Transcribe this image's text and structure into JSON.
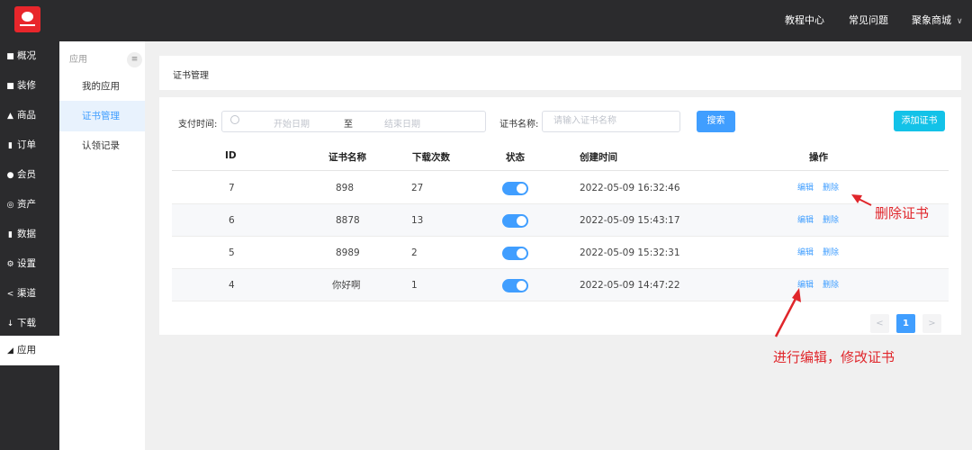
{
  "header": {
    "nav": [
      "教程中心",
      "常见问题",
      "聚象商城"
    ],
    "colors": {
      "bar": "#2b2b2d",
      "logo": "#e8262b"
    }
  },
  "sidebar": {
    "items": [
      {
        "label": "概况",
        "icon": "monitor-icon"
      },
      {
        "label": "装修",
        "icon": "monitor-icon"
      },
      {
        "label": "商品",
        "icon": "shop-icon"
      },
      {
        "label": "订单",
        "icon": "document-icon"
      },
      {
        "label": "会员",
        "icon": "user-icon"
      },
      {
        "label": "资产",
        "icon": "database-icon"
      },
      {
        "label": "数据",
        "icon": "bar-chart-icon"
      },
      {
        "label": "设置",
        "icon": "gear-icon"
      },
      {
        "label": "渠道",
        "icon": "share-icon"
      },
      {
        "label": "下载",
        "icon": "download-icon"
      },
      {
        "label": "应用",
        "icon": "app-icon",
        "active": true
      }
    ]
  },
  "subnav": {
    "title": "应用",
    "items": [
      {
        "label": "我的应用"
      },
      {
        "label": "证书管理",
        "active": true
      },
      {
        "label": "认领记录"
      }
    ]
  },
  "page": {
    "breadcrumb": "证书管理"
  },
  "filters": {
    "pay_time_label": "支付时间:",
    "start_placeholder": "开始日期",
    "range_sep": "至",
    "end_placeholder": "结束日期",
    "cert_name_label": "证书名称:",
    "cert_name_placeholder": "请输入证书名称",
    "search_label": "搜索",
    "add_label": "添加证书"
  },
  "table": {
    "headers": [
      "ID",
      "证书名称",
      "下载次数",
      "状态",
      "创建时间",
      "操作"
    ],
    "rows": [
      {
        "id": "7",
        "name": "898",
        "downloads": "27",
        "enabled": true,
        "created": "2022-05-09 16:32:46",
        "edit": "编辑",
        "delete": "删除"
      },
      {
        "id": "6",
        "name": "8878",
        "downloads": "13",
        "enabled": true,
        "created": "2022-05-09 15:43:17",
        "edit": "编辑",
        "delete": "删除"
      },
      {
        "id": "5",
        "name": "8989",
        "downloads": "2",
        "enabled": true,
        "created": "2022-05-09 15:32:31",
        "edit": "编辑",
        "delete": "删除"
      },
      {
        "id": "4",
        "name": "你好啊",
        "downloads": "1",
        "enabled": true,
        "created": "2022-05-09 14:47:22",
        "edit": "编辑",
        "delete": "删除"
      }
    ]
  },
  "pagination": {
    "prev": "<",
    "current": "1",
    "next": ">"
  },
  "annotations": {
    "delete_note": "删除证书",
    "edit_note": "进行编辑，修改证书"
  },
  "colors": {
    "primary": "#409eff",
    "add_button": "#13c2e8",
    "annotation": "#e0262b"
  }
}
